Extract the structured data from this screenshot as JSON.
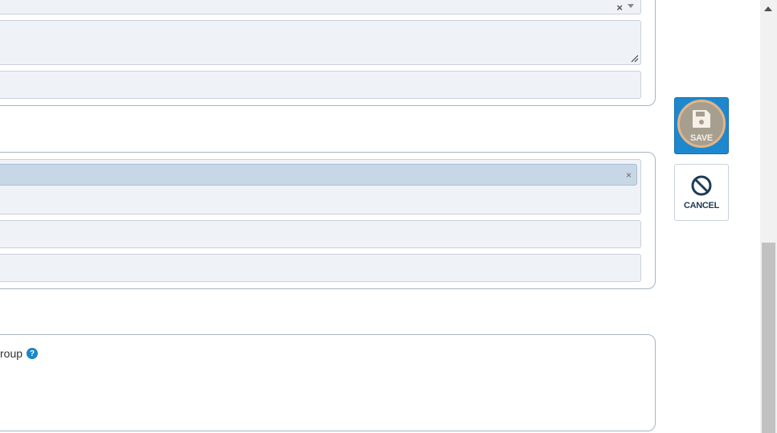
{
  "form": {
    "select_clear_symbol": "×",
    "tag_clear_symbol": "×",
    "group_label": "roup",
    "help_symbol": "?"
  },
  "actions": {
    "save_label": "SAVE",
    "cancel_label": "CANCEL",
    "save_color": "#1e88cf",
    "save_icon": "floppy-disk-icon",
    "cancel_icon": "ban-icon"
  },
  "scrollbar": {
    "up_icon": "triangle-up-icon"
  }
}
